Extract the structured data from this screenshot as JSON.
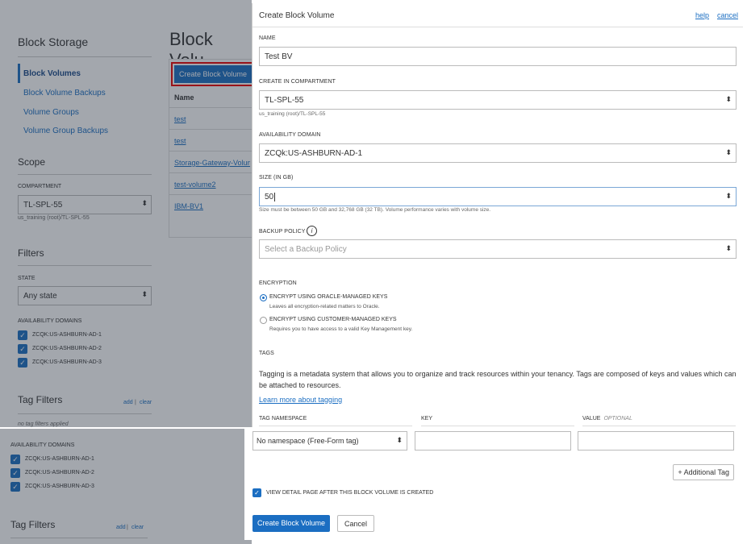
{
  "background": {
    "sidebar": {
      "title": "Block Storage",
      "items": [
        {
          "label": "Block Volumes"
        },
        {
          "label": "Block Volume Backups"
        },
        {
          "label": "Volume Groups"
        },
        {
          "label": "Volume Group Backups"
        }
      ],
      "scope_title": "Scope",
      "compartment_label": "COMPARTMENT",
      "compartment_value": "TL-SPL-55",
      "compartment_path": "us_training (root)/TL-SPL-55",
      "filters_title": "Filters",
      "state_label": "STATE",
      "state_value": "Any state",
      "ad_label": "AVAILABILITY DOMAINS",
      "ads": [
        "ZCQK:US-ASHBURN-AD-1",
        "ZCQK:US-ASHBURN-AD-2",
        "ZCQK:US-ASHBURN-AD-3"
      ],
      "tag_filters_title": "Tag Filters",
      "tag_add": "add",
      "tag_sep": " | ",
      "tag_clear": "clear",
      "no_tag_filters": "no tag filters applied"
    },
    "main": {
      "title": "Block Volu",
      "create_button": "Create Block Volume",
      "column_name": "Name",
      "rows": [
        "test",
        "test",
        "Storage-Gateway-Volume",
        "test-volume2",
        "IBM-BV1"
      ]
    }
  },
  "panel": {
    "title": "Create Block Volume",
    "help": "help",
    "cancel": "cancel",
    "name_label": "NAME",
    "name_value": "Test BV",
    "compartment_label": "CREATE IN COMPARTMENT",
    "compartment_value": "TL-SPL-55",
    "compartment_path": "us_training (root)/TL-SPL-55",
    "ad_label": "AVAILABILITY DOMAIN",
    "ad_value": "ZCQk:US-ASHBURN-AD-1",
    "size_label": "SIZE (IN GB)",
    "size_value": "50",
    "size_hint": "Size must be between 50 GB and 32,768 GB (32 TB). Volume performance varies with volume size.",
    "backup_label": "BACKUP POLICY",
    "backup_placeholder": "Select a Backup Policy",
    "encryption_label": "ENCRYPTION",
    "enc_oracle_label": "ENCRYPT USING ORACLE-MANAGED KEYS",
    "enc_oracle_desc": "Leaves all encryption-related matters to Oracle.",
    "enc_customer_label": "ENCRYPT USING CUSTOMER-MANAGED KEYS",
    "enc_customer_desc": "Requires you to have access to a valid Key Management key.",
    "tags_label": "TAGS",
    "tags_text": "Tagging is a metadata system that allows you to organize and track resources within your tenancy. Tags are composed of keys and values which can be attached to resources.",
    "learn_more": "Learn more about tagging",
    "col_namespace": "TAG NAMESPACE",
    "col_key": "KEY",
    "col_value": "VALUE",
    "col_optional": "OPTIONAL",
    "namespace_value": "No namespace (Free-Form tag)",
    "additional_tag": "+ Additional Tag",
    "view_detail": "VIEW DETAIL PAGE AFTER THIS BLOCK VOLUME IS CREATED",
    "create_button": "Create Block Volume",
    "cancel_button": "Cancel"
  },
  "colors": {
    "accent": "#1b6ec2",
    "highlight": "#e00000"
  }
}
